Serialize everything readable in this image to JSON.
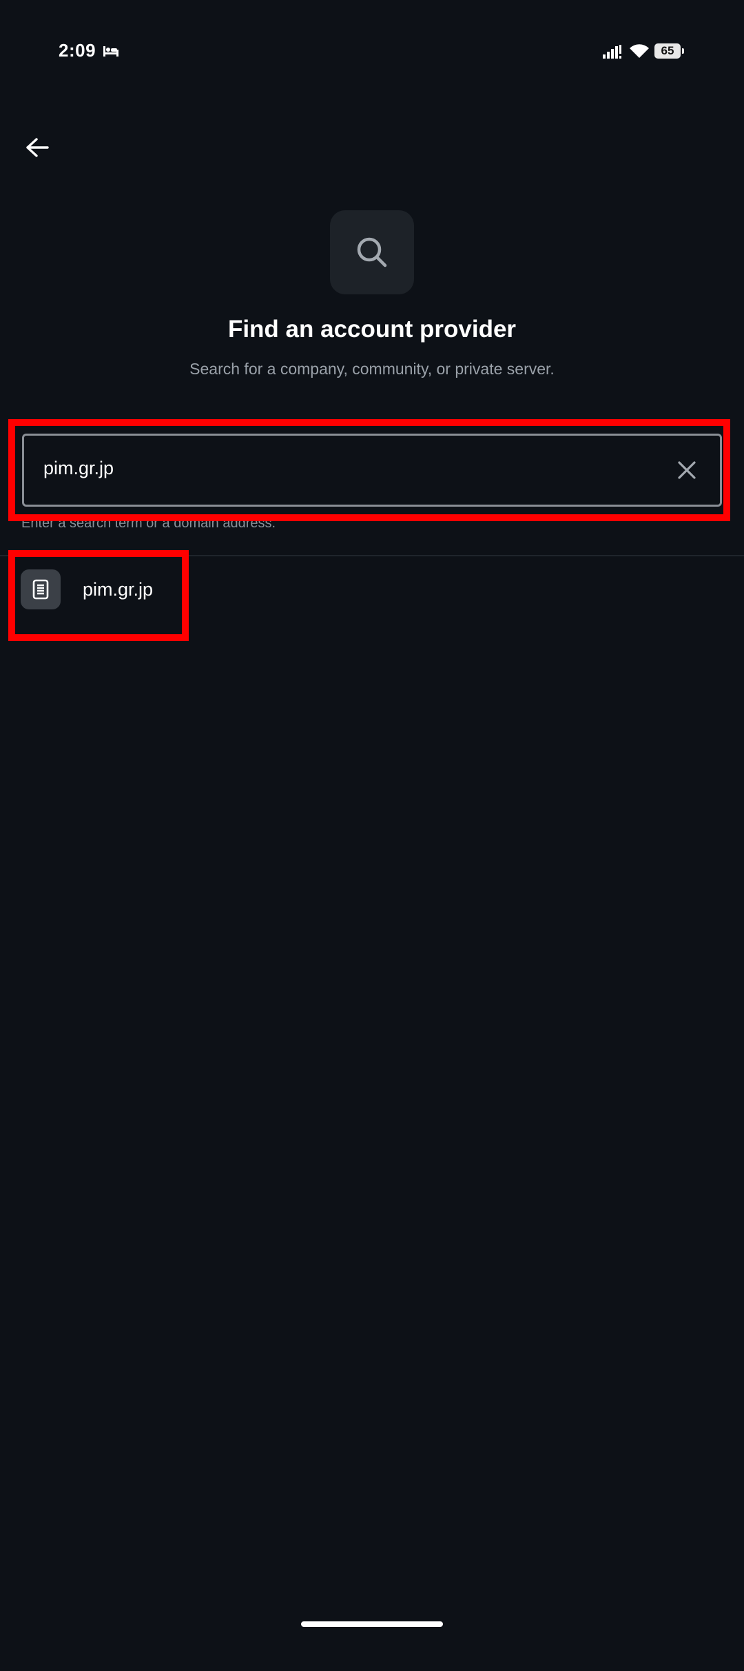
{
  "status_bar": {
    "time": "2:09",
    "battery_level": "65",
    "icons": [
      "sleep-icon",
      "signal-icon",
      "wifi-icon",
      "battery-icon"
    ]
  },
  "header": {
    "back_icon": "arrow-left-icon"
  },
  "hero": {
    "icon": "search-icon",
    "title": "Find an account provider",
    "subtitle": "Search for a company, community, or private server."
  },
  "search": {
    "value": "pim.gr.jp",
    "helper": "Enter a search term or a domain address.",
    "clear_icon": "close-icon"
  },
  "results": [
    {
      "label": "pim.gr.jp",
      "icon": "server-icon"
    }
  ],
  "colors": {
    "background": "#0d1117",
    "highlight": "#ff0000",
    "field_border": "#8a8f96",
    "muted_text": "#9aa1a9"
  }
}
